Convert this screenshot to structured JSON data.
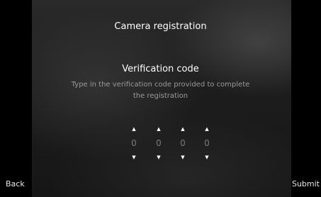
{
  "screen": {
    "title": "Camera registration",
    "heading": "Verification code",
    "description": "Type in the verification code provided to complete the registration"
  },
  "code": {
    "digits": [
      "0",
      "0",
      "0",
      "0"
    ],
    "up_icon": "chevron-up-icon",
    "down_icon": "chevron-down-icon"
  },
  "footer": {
    "back_label": "Back",
    "submit_label": "Submit"
  },
  "colors": {
    "background": "#000000",
    "text_primary": "#ffffff",
    "text_secondary": "#9a9a9a",
    "digit": "#7a7a7a"
  }
}
